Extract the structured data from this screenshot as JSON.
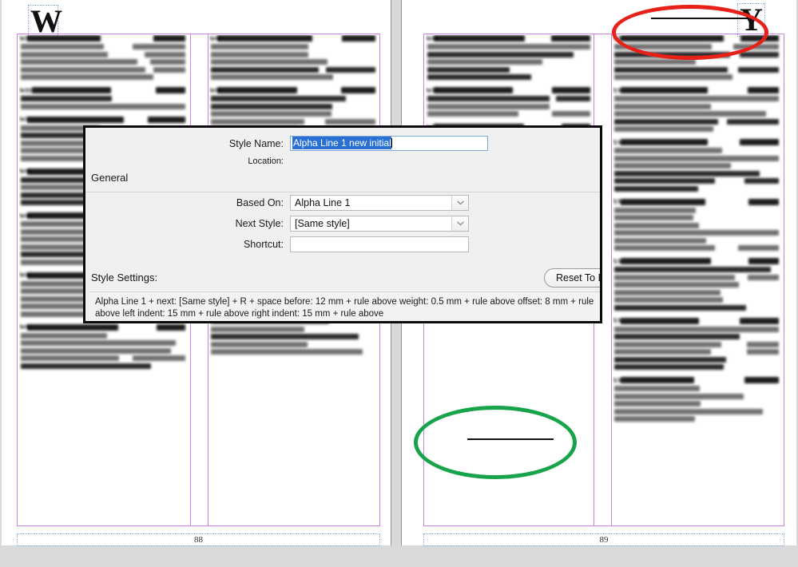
{
  "app": {
    "context": "indesign-style-document-spread"
  },
  "document": {
    "left_page": {
      "section_letter": "W",
      "folio": "88",
      "columns": [
        {
          "entries": [
            {
              "prefix": "WI",
              "bullet": false,
              "lines": 6
            },
            {
              "prefix": "WIS",
              "bullet": false,
              "lines": 3
            },
            {
              "prefix": "WI",
              "bullet": false,
              "lines": 6
            },
            {
              "prefix": "WO",
              "bullet": true,
              "lines": 5
            },
            {
              "prefix": "WO",
              "bullet": true,
              "lines": 7
            },
            {
              "prefix": "WO",
              "bullet": true,
              "lines": 6
            },
            {
              "prefix": "WO",
              "bullet": true,
              "lines": 6
            }
          ]
        },
        {
          "entries": [
            {
              "prefix": "WO",
              "bullet": false,
              "lines": 6
            },
            {
              "prefix": "WO",
              "bullet": false,
              "lines": 6
            },
            {
              "prefix": "WO",
              "bullet": false,
              "lines": 6
            },
            {
              "prefix": "WO",
              "bullet": false,
              "lines": 7
            },
            {
              "prefix": "WO",
              "bullet": false,
              "lines": 7
            },
            {
              "prefix": "WO",
              "bullet": false,
              "lines": 6
            }
          ]
        }
      ]
    },
    "right_page": {
      "section_letter": "Y",
      "folio": "89",
      "columns": [
        {
          "entries": [
            {
              "prefix": "WO",
              "bullet": true,
              "lines": 6
            },
            {
              "prefix": "WU",
              "bullet": true,
              "lines": 4
            },
            {
              "prefix": "WU",
              "bullet": false,
              "lines": 5
            },
            {
              "prefix": "XU",
              "bullet": false,
              "lines": 6
            }
          ]
        },
        {
          "entries": [
            {
              "prefix": "YA",
              "bullet": false,
              "lines": 6
            },
            {
              "prefix": "YA",
              "bullet": false,
              "lines": 6
            },
            {
              "prefix": "YA",
              "bullet": true,
              "lines": 7
            },
            {
              "prefix": "YA",
              "bullet": true,
              "lines": 7
            },
            {
              "prefix": "YA",
              "bullet": true,
              "lines": 7
            },
            {
              "prefix": "YA",
              "bullet": true,
              "lines": 7
            },
            {
              "prefix": "YA",
              "bullet": false,
              "lines": 6
            }
          ]
        }
      ]
    }
  },
  "annotations": [
    {
      "shape": "ellipse",
      "color": "#e8201a",
      "label": "red-highlight-rule-above-Y"
    },
    {
      "shape": "ellipse",
      "color": "#16a34a",
      "label": "green-highlight-rule-above-XU"
    }
  ],
  "dialog": {
    "style_name": {
      "label": "Style Name:",
      "value": "Alpha Line 1 new initial",
      "selected": true
    },
    "location": {
      "label": "Location:",
      "value": ""
    },
    "general_heading": "General",
    "based_on": {
      "label": "Based On:",
      "value": "Alpha Line 1"
    },
    "next_style": {
      "label": "Next Style:",
      "value": "[Same style]"
    },
    "shortcut": {
      "label": "Shortcut:",
      "value": ""
    },
    "style_settings": {
      "label": "Style Settings:",
      "reset_button": "Reset To Base",
      "description": "Alpha Line 1 + next: [Same style] + R + space before: 12 mm + rule above weight: 0.5 mm + rule above offset: 8 mm + rule above left indent: 15 mm + rule above right indent: 15 mm + rule above"
    },
    "icons": {
      "chevron_down": "chevron-down-icon"
    }
  },
  "colors": {
    "selection_blue": "#2a6fd4",
    "input_focus_border": "#7ba7d9",
    "margin_guide": "#cf7fe8",
    "frame_guide": "#7aa8e0",
    "annotation_red": "#e8201a",
    "annotation_green": "#16a34a",
    "dialog_bg": "#f0f0f0",
    "canvas_bg": "#d9d9d9"
  }
}
